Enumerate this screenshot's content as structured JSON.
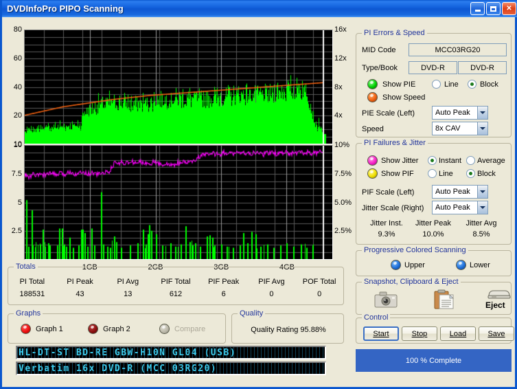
{
  "window": {
    "title": "DVDInfoPro PIPO Scanning",
    "minimize_label": "Minimize",
    "maximize_label": "Maximize",
    "close_label": "Close"
  },
  "chart_data": [
    {
      "type": "bar",
      "title": "PI Errors and Speed",
      "xlabel": "",
      "ylabel": "PI Errors",
      "y_left_ticks": [
        "80",
        "60",
        "40",
        "20",
        "10"
      ],
      "y_left_values": [
        80,
        60,
        40,
        20,
        10
      ],
      "ylim": [
        0,
        80
      ],
      "y_right_ticks": [
        "16x",
        "12x",
        "8x",
        "4x"
      ],
      "y_right_values": [
        16,
        12,
        8,
        4
      ],
      "y_right_lim": [
        0,
        16
      ],
      "x_ticks": [
        "1GB",
        "2GB",
        "3GB",
        "4GB"
      ],
      "x_values": [
        1,
        2,
        3,
        4
      ],
      "xlim": [
        0,
        4.7
      ],
      "grid": true,
      "legend": [
        "PIE",
        "Speed"
      ],
      "series": [
        {
          "name": "PIE",
          "color": "#00FF00",
          "style": "block",
          "axis": "left",
          "values": [
            8,
            9,
            7,
            10,
            8,
            11,
            9,
            8,
            12,
            9,
            10,
            8,
            11,
            9,
            13,
            10,
            9,
            11,
            8,
            12,
            10,
            9,
            13,
            11,
            10,
            12,
            9,
            11,
            14,
            10,
            12,
            9,
            11,
            13,
            10,
            12,
            11,
            9,
            13,
            10,
            12,
            11,
            14,
            10,
            12,
            11,
            13,
            10,
            12,
            14,
            11,
            13,
            10,
            12,
            11,
            14,
            12,
            10,
            13,
            11,
            12,
            14,
            11,
            13,
            12,
            10,
            14,
            12,
            13,
            11,
            14,
            12,
            13,
            11,
            15,
            12,
            14,
            13,
            11,
            14,
            18,
            20,
            22,
            19,
            24,
            21,
            23,
            20,
            25,
            22,
            24,
            21,
            26,
            23,
            25,
            22,
            27,
            24,
            26,
            23,
            25,
            28,
            24,
            30,
            26,
            28,
            25,
            27,
            24,
            29,
            26,
            28,
            25,
            27,
            30,
            26,
            28,
            25,
            32,
            27,
            29,
            26,
            28,
            31,
            27,
            29,
            26,
            28,
            30,
            27,
            29,
            26,
            31,
            28,
            30,
            27,
            29,
            26,
            28,
            31,
            27,
            29,
            26,
            28,
            30,
            27,
            25,
            28,
            26,
            29,
            27,
            25,
            28,
            26,
            30,
            27,
            25,
            28,
            26,
            29,
            27,
            30,
            26,
            28,
            25,
            31,
            27,
            29,
            26,
            28,
            30,
            27,
            29,
            26,
            28,
            31,
            27,
            29,
            26,
            28,
            30,
            32,
            28,
            31,
            29,
            33,
            30,
            28,
            31,
            29,
            32,
            30,
            28,
            31,
            29,
            33,
            30,
            28,
            31,
            29,
            32,
            30,
            33,
            29,
            31,
            28,
            34,
            30,
            32,
            29,
            31,
            33,
            30,
            28,
            31,
            29,
            32,
            30,
            33,
            29,
            31,
            34,
            30,
            32,
            29,
            31,
            28,
            33,
            30,
            32,
            29,
            36,
            31,
            28,
            33,
            30,
            32,
            29,
            31,
            34,
            30,
            32,
            29,
            31,
            33,
            30,
            28,
            32,
            29,
            31,
            34,
            30,
            32,
            29,
            31,
            33,
            30,
            28,
            32,
            35,
            30,
            32,
            29,
            31,
            33,
            36,
            30,
            32,
            29,
            34,
            31,
            33,
            30,
            32,
            35,
            29,
            31,
            33,
            30,
            32,
            34,
            31,
            33,
            30,
            36,
            32,
            34,
            31,
            33,
            30,
            35,
            32,
            34,
            31,
            33,
            38,
            32,
            34,
            31,
            36,
            33,
            35,
            32,
            34,
            31,
            37,
            33,
            35,
            32,
            34,
            36,
            33,
            35,
            32,
            34,
            31,
            37,
            33,
            35,
            32,
            34,
            36,
            33,
            31,
            35,
            32,
            34,
            30,
            36,
            33,
            35,
            32,
            34,
            31,
            36,
            33,
            35,
            32,
            34,
            30,
            33,
            35,
            32,
            34,
            31,
            36,
            33,
            35,
            32,
            38,
            34,
            36,
            33,
            40,
            35,
            37,
            34,
            36,
            33,
            41,
            38,
            36,
            34,
            39,
            37,
            35,
            33,
            40,
            38,
            36,
            34,
            42,
            39,
            37,
            35,
            33,
            40,
            38,
            36,
            34,
            39,
            37,
            35,
            43,
            40,
            38,
            36,
            34,
            41,
            39,
            37,
            35,
            33,
            40,
            38,
            36,
            34,
            32,
            30,
            28,
            26,
            24,
            22,
            20,
            18,
            16,
            14,
            13,
            12,
            11,
            10,
            16,
            14,
            12,
            10,
            9,
            8,
            7
          ]
        },
        {
          "name": "Speed",
          "color": "#F06010",
          "style": "line",
          "axis": "right",
          "description": "Monotonically increasing read speed curve from ~4.0x at start to ~8.6x at end (8x CAV)",
          "values": [
            4.0,
            4.3,
            4.6,
            4.9,
            5.2,
            5.4,
            5.6,
            5.8,
            6.0,
            6.2,
            6.35,
            6.5,
            6.65,
            6.8,
            6.9,
            7.0,
            7.1,
            7.2,
            7.3,
            7.4,
            7.5,
            7.6,
            7.7,
            7.8,
            7.9,
            8.0,
            8.1,
            8.2,
            8.3,
            8.4,
            8.5,
            8.6
          ]
        }
      ]
    },
    {
      "type": "line",
      "title": "PI Failures and Jitter",
      "xlabel": "",
      "ylabel": "PI Failures",
      "y_left_ticks": [
        "10",
        "7.5",
        "5",
        "2.5"
      ],
      "y_left_values": [
        10,
        7.5,
        5,
        2.5
      ],
      "ylim": [
        0,
        10
      ],
      "y_right_ticks": [
        "10%",
        "7.5%",
        "5.0%",
        "2.5%"
      ],
      "y_right_values": [
        10,
        7.5,
        5.0,
        2.5
      ],
      "y_right_lim": [
        0,
        10
      ],
      "x_ticks": [
        "1GB",
        "2GB",
        "3GB",
        "4GB"
      ],
      "x_values": [
        1,
        2,
        3,
        4
      ],
      "xlim": [
        0,
        4.7
      ],
      "grid": true,
      "legend": [
        "Jitter",
        "PIF"
      ],
      "series": [
        {
          "name": "Jitter",
          "color": "#FF00FF",
          "style": "line",
          "axis": "right",
          "description": "Noisy jitter trace rising from ~7.4% to ~9.5%",
          "values": [
            7.45,
            7.3,
            7.2,
            7.5,
            7.4,
            7.35,
            7.55,
            7.4,
            7.5,
            7.45,
            7.6,
            7.5,
            7.4,
            7.55,
            7.5,
            7.45,
            7.6,
            7.75,
            7.6,
            7.5,
            7.65,
            7.55,
            7.7,
            7.6,
            7.5,
            7.65,
            7.55,
            7.45,
            7.6,
            7.5,
            7.7,
            7.6,
            7.9,
            8.3,
            8.55,
            8.4,
            8.6,
            8.45,
            8.55,
            8.4,
            8.6,
            8.5,
            8.45,
            8.6,
            8.5,
            8.4,
            8.55,
            8.45,
            8.6,
            8.5,
            8.4,
            8.3,
            8.45,
            8.35,
            8.25,
            8.4,
            8.3,
            8.5,
            8.4,
            8.55,
            8.45,
            8.6,
            8.5,
            8.65,
            8.8,
            9.0,
            9.2,
            9.1,
            9.3,
            9.15,
            9.35,
            9.2,
            9.4,
            9.25,
            9.45,
            9.3,
            9.2,
            9.4,
            9.3,
            9.5,
            9.35,
            9.25,
            9.4,
            9.3,
            9.2,
            9.35,
            9.25,
            9.45,
            9.3,
            9.2,
            9.4,
            9.3,
            9.5,
            9.35,
            9.25,
            9.4,
            9.3,
            9.45,
            9.35,
            9.2,
            9.4,
            9.3,
            9.5,
            9.4,
            9.3,
            9.45,
            9.35,
            9.25,
            9.4,
            9.3,
            9.5,
            9.35
          ]
        },
        {
          "name": "PIF",
          "color": "#00FF00",
          "style": "block",
          "axis": "left",
          "description": "Sparse PI Failure spikes, mostly 1-2, with scattered peaks to 5-6",
          "spikes": [
            {
              "x": 0.02,
              "y": 5.2
            },
            {
              "x": 0.05,
              "y": 1.1
            },
            {
              "x": 0.1,
              "y": 4.3
            },
            {
              "x": 0.12,
              "y": 1.2
            },
            {
              "x": 0.16,
              "y": 1.0
            },
            {
              "x": 0.23,
              "y": 1.3
            },
            {
              "x": 0.27,
              "y": 2.6
            },
            {
              "x": 0.3,
              "y": 1.1
            },
            {
              "x": 0.36,
              "y": 1.4
            },
            {
              "x": 0.38,
              "y": 1.2
            },
            {
              "x": 0.49,
              "y": 1.2
            },
            {
              "x": 0.52,
              "y": 2.7
            },
            {
              "x": 0.57,
              "y": 2.7
            },
            {
              "x": 0.6,
              "y": 1.3
            },
            {
              "x": 0.63,
              "y": 1.1
            },
            {
              "x": 0.68,
              "y": 1.9
            },
            {
              "x": 0.73,
              "y": 1.0
            },
            {
              "x": 0.82,
              "y": 1.2
            },
            {
              "x": 0.86,
              "y": 2.6
            },
            {
              "x": 0.88,
              "y": 2.6
            },
            {
              "x": 0.91,
              "y": 2.3
            },
            {
              "x": 0.95,
              "y": 1.1
            },
            {
              "x": 1.02,
              "y": 2.7
            },
            {
              "x": 1.06,
              "y": 1.2
            },
            {
              "x": 1.16,
              "y": 5.9
            },
            {
              "x": 1.2,
              "y": 1.3
            },
            {
              "x": 1.26,
              "y": 1.1
            },
            {
              "x": 1.3,
              "y": 1.0
            },
            {
              "x": 1.36,
              "y": 2.0
            },
            {
              "x": 1.4,
              "y": 1.5
            },
            {
              "x": 1.47,
              "y": 1.0
            },
            {
              "x": 1.6,
              "y": 1.2
            },
            {
              "x": 1.72,
              "y": 1.4
            },
            {
              "x": 1.8,
              "y": 2.6
            },
            {
              "x": 1.85,
              "y": 1.3
            },
            {
              "x": 1.88,
              "y": 2.2
            },
            {
              "x": 1.9,
              "y": 3.0
            },
            {
              "x": 1.93,
              "y": 2.5
            },
            {
              "x": 2.0,
              "y": 2.2
            },
            {
              "x": 2.1,
              "y": 1.2
            },
            {
              "x": 2.22,
              "y": 1.4
            },
            {
              "x": 2.3,
              "y": 1.1
            },
            {
              "x": 2.38,
              "y": 1.3
            },
            {
              "x": 2.46,
              "y": 2.9
            },
            {
              "x": 2.52,
              "y": 1.5
            },
            {
              "x": 2.56,
              "y": 1.2
            },
            {
              "x": 2.6,
              "y": 1.4
            },
            {
              "x": 2.68,
              "y": 1.1
            },
            {
              "x": 2.78,
              "y": 2.0
            },
            {
              "x": 2.82,
              "y": 2.1
            },
            {
              "x": 2.86,
              "y": 1.9
            },
            {
              "x": 2.9,
              "y": 1.2
            },
            {
              "x": 3.0,
              "y": 1.3
            },
            {
              "x": 3.08,
              "y": 1.1
            },
            {
              "x": 3.18,
              "y": 1.0
            },
            {
              "x": 3.28,
              "y": 1.2
            },
            {
              "x": 3.34,
              "y": 2.3
            },
            {
              "x": 3.4,
              "y": 1.4
            },
            {
              "x": 3.46,
              "y": 2.4
            },
            {
              "x": 3.52,
              "y": 2.2
            },
            {
              "x": 3.6,
              "y": 1.1
            },
            {
              "x": 3.7,
              "y": 1.3
            },
            {
              "x": 3.8,
              "y": 1.0
            },
            {
              "x": 3.9,
              "y": 1.2
            },
            {
              "x": 4.0,
              "y": 1.4
            },
            {
              "x": 4.1,
              "y": 1.1
            },
            {
              "x": 4.22,
              "y": 1.3
            },
            {
              "x": 4.3,
              "y": 1.0
            },
            {
              "x": 4.4,
              "y": 1.2
            }
          ]
        }
      ]
    }
  ],
  "pi_errors_speed": {
    "caption": "PI Errors & Speed",
    "mid_code_label": "MID Code",
    "mid_code_value": "MCC03RG20",
    "type_book_label": "Type/Book",
    "type_value": "DVD-R",
    "book_value": "DVD-R",
    "show_pie_label": "Show PIE",
    "show_pie_color": "#00D000",
    "show_speed_label": "Show Speed",
    "show_speed_color": "#F06010",
    "line_label": "Line",
    "block_label": "Block",
    "pie_scale_label": "PIE Scale (Left)",
    "pie_scale_value": "Auto Peak",
    "speed_label": "Speed",
    "speed_value": "8x CAV"
  },
  "pi_failures_jitter": {
    "caption": "PI Failures & Jitter",
    "show_jitter_label": "Show Jitter",
    "show_jitter_color": "#F820C8",
    "show_pif_label": "Show PIF",
    "show_pif_color": "#F0E000",
    "instant_label": "Instant",
    "average_label": "Average",
    "line_label": "Line",
    "block_label": "Block",
    "pif_scale_label": "PIF Scale (Left)",
    "pif_scale_value": "Auto Peak",
    "jitter_scale_label": "Jitter Scale (Right)",
    "jitter_scale_value": "Auto Peak",
    "jitter_inst_label": "Jitter Inst.",
    "jitter_inst_value": "9.3%",
    "jitter_peak_label": "Jitter Peak",
    "jitter_peak_value": "10.0%",
    "jitter_avg_label": "Jitter Avg",
    "jitter_avg_value": "8.5%"
  },
  "progressive": {
    "caption": "Progressive Colored Scanning",
    "upper_label": "Upper",
    "lower_label": "Lower",
    "led_color": "#1E6FD9"
  },
  "snapshot": {
    "caption": "Snapshot,  Clipboard  & Eject",
    "camera_name": "Snapshot",
    "clipboard_name": "Clipboard",
    "eject_label": "Eject"
  },
  "control": {
    "caption": "Control",
    "start_label": "Start",
    "stop_label": "Stop",
    "load_label": "Load",
    "save_label": "Save"
  },
  "progress": {
    "text": "100 % Complete",
    "percent": 100,
    "color": "#3465C4"
  },
  "totals": {
    "caption": "Totals",
    "headers": [
      "PI Total",
      "PI Peak",
      "PI Avg",
      "PIF Total",
      "PIF Peak",
      "PIF Avg",
      "POF Total"
    ],
    "values": [
      "188531",
      "43",
      "13",
      "612",
      "6",
      "0",
      "0"
    ]
  },
  "graphs": {
    "caption": "Graphs",
    "graph1_label": "Graph 1",
    "graph1_color": "#F01010",
    "graph2_label": "Graph 2",
    "graph2_color": "#8B1010",
    "compare_label": "Compare",
    "compare_color": "#BDBAAB"
  },
  "quality": {
    "caption": "Quality",
    "rating_text": "Quality Rating 95.88%"
  },
  "lcd": {
    "drive": "HL-DT-ST BD-RE GBW-H10N GL04 (USB)",
    "media": "Verbatim 16x DVD-R (MCC 03RG20)"
  }
}
